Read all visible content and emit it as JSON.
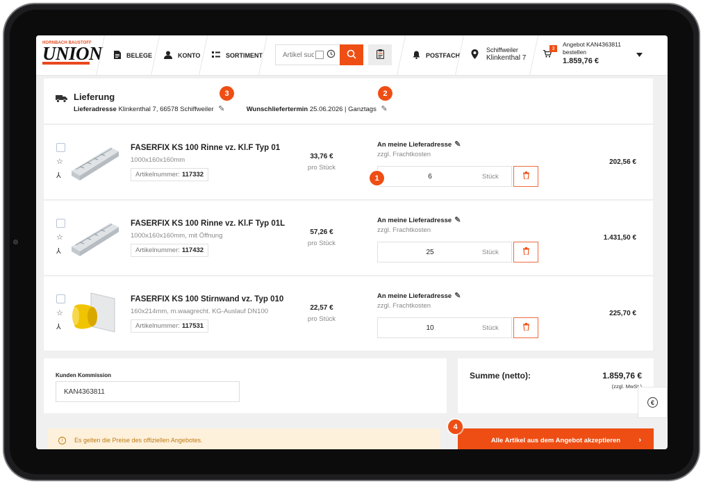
{
  "header": {
    "logo_top": "HORNBACH BAUSTOFF",
    "logo_main": "UNION",
    "nav": [
      {
        "label": "BELEGE",
        "icon": "document-icon"
      },
      {
        "label": "KONTO",
        "icon": "user-icon"
      },
      {
        "label": "SORTIMENT",
        "icon": "list-icon"
      }
    ],
    "search_placeholder": "Artikel suchen",
    "postfach": "POSTFACH",
    "address_line1": "Schiffweiler",
    "address_line2": "Klinkenthal 7",
    "cart_count": "3",
    "cart_line1": "Angebot KAN4363811",
    "cart_line2": "bestellen",
    "cart_amount": "1.859,76 €"
  },
  "delivery": {
    "title": "Lieferung",
    "address_label": "Lieferadresse",
    "address_value": "Klinkenthal 7, 66578 Schiffweiler",
    "date_label": "Wunschliefertermin",
    "date_value": "25.06.2026 | Ganztags"
  },
  "badges": [
    "1",
    "2",
    "3",
    "4"
  ],
  "items": [
    {
      "name": "FASERFIX KS 100 Rinne vz. Kl.F Typ 01",
      "dims": "1000x160x160mm",
      "art_label": "Artikelnummer:",
      "art_nr": "117332",
      "price": "33,76 €",
      "per": "pro Stück",
      "ship": "An meine Lieferadresse",
      "ship_sub": "zzgl. Frachtkosten",
      "qty": "6",
      "unit": "Stück",
      "total": "202,56 €"
    },
    {
      "name": "FASERFIX KS 100 Rinne vz. Kl.F Typ 01L",
      "dims": "1000x160x160mm, mit Öffnung",
      "art_label": "Artikelnummer:",
      "art_nr": "117432",
      "price": "57,26 €",
      "per": "pro Stück",
      "ship": "An meine Lieferadresse",
      "ship_sub": "zzgl. Frachtkosten",
      "qty": "25",
      "unit": "Stück",
      "total": "1.431,50 €"
    },
    {
      "name": "FASERFIX KS 100 Stirnwand vz. Typ 010",
      "dims": "160x214mm, m.waagrecht. KG-Auslauf DN100",
      "art_label": "Artikelnummer:",
      "art_nr": "117531",
      "price": "22,57 €",
      "per": "pro Stück",
      "ship": "An meine Lieferadresse",
      "ship_sub": "zzgl. Frachtkosten",
      "qty": "10",
      "unit": "Stück",
      "total": "225,70 €"
    }
  ],
  "kommission": {
    "label": "Kunden Kommission",
    "value": "KAN4363811"
  },
  "summary": {
    "label": "Summe (netto):",
    "amount": "1.859,76 €",
    "tax_note": "(zzgl. MwSt.)"
  },
  "info_text": "Es gelten die Preise des offiziellen Angebotes.",
  "accept_button": "Alle Artikel aus dem Angebot akzeptieren",
  "colors": {
    "accent": "#ee4e14",
    "info_bg": "#fdf1dc"
  }
}
